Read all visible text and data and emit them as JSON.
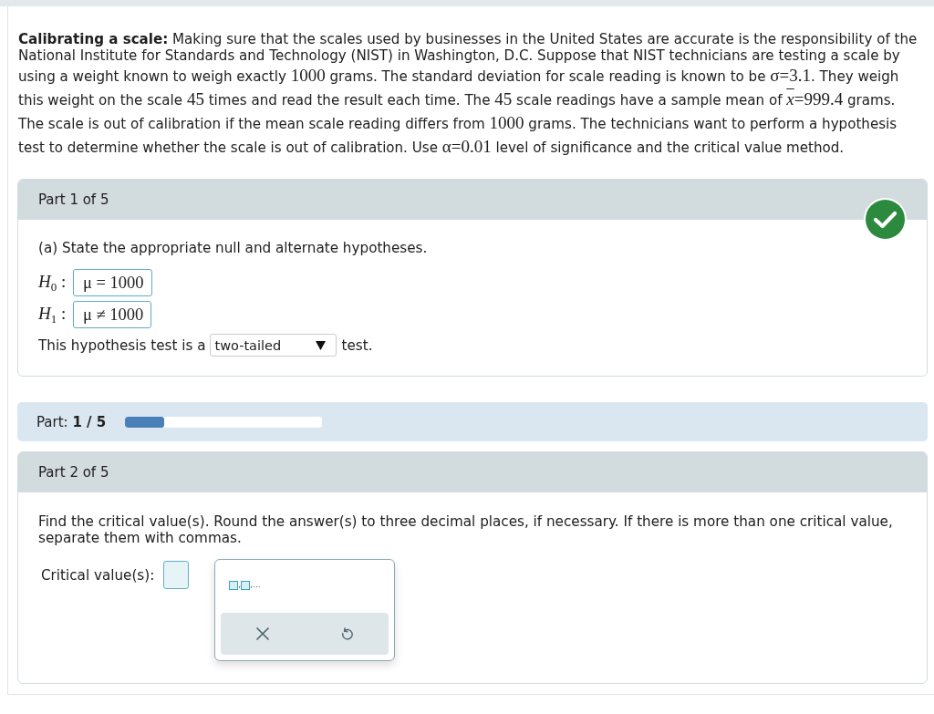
{
  "problem": {
    "segments": [
      {
        "kind": "bold",
        "text": "Calibrating a scale:"
      },
      {
        "kind": "text",
        "text": " Making sure that the scales used by businesses in the United States are accurate is the responsibility of the National Institute for Standards and Technology (NIST) in Washington, D.C. Suppose that NIST technicians are testing a scale by using a weight known to weigh exactly "
      },
      {
        "kind": "math",
        "text": "1000"
      },
      {
        "kind": "text",
        "text": " grams. The standard deviation for scale reading is known to be "
      },
      {
        "kind": "math",
        "text": "σ=3.1"
      },
      {
        "kind": "text",
        "text": ". They weigh this weight on the scale "
      },
      {
        "kind": "math",
        "text": "45"
      },
      {
        "kind": "text",
        "text": " times and read the result each time. The "
      },
      {
        "kind": "math",
        "text": "45"
      },
      {
        "kind": "text",
        "text": " scale readings have a sample mean of "
      },
      {
        "kind": "mean",
        "text": "x"
      },
      {
        "kind": "math",
        "text": "=999.4"
      },
      {
        "kind": "text",
        "text": " grams. The scale is out of calibration if the mean scale reading differs from "
      },
      {
        "kind": "math",
        "text": "1000"
      },
      {
        "kind": "text",
        "text": " grams. The technicians want to perform a hypothesis test to determine whether the scale is out of calibration. Use "
      },
      {
        "kind": "math",
        "text": "α=0.01"
      },
      {
        "kind": "text",
        "text": " level of significance and the critical value method."
      }
    ]
  },
  "sections": [
    {
      "kind": "hypotheses_part",
      "header": "Part 1 of 5",
      "correct": true,
      "prompt": "(a) State the appropriate null and alternate hypotheses.",
      "hypotheses": [
        {
          "label": "*H*$_{0}$ :",
          "value": "μ = 1000"
        },
        {
          "label": "*H*$_{1}$ :",
          "value": "μ ≠ 1000"
        }
      ],
      "test_sentence": {
        "before": "This hypothesis test is a",
        "choice": "two-tailed",
        "after": "test."
      }
    },
    {
      "kind": "progress",
      "label": "Part: **1 / 5**",
      "level": 0.2
    },
    {
      "kind": "critical_value_part",
      "header": "Part 2 of 5",
      "correct": false,
      "prompt": "Find the critical value(s). Round the answer(s) to three decimal places, if necessary. If there is more than one critical value, separate them with commas.",
      "answer_label": "Critical value(s):",
      "keypad": {
        "template": [
          {
            "kind": "slot"
          },
          {
            "kind": "text",
            "text": ","
          },
          {
            "kind": "slot"
          },
          {
            "kind": "text",
            "text": ",..."
          }
        ]
      }
    }
  ]
}
